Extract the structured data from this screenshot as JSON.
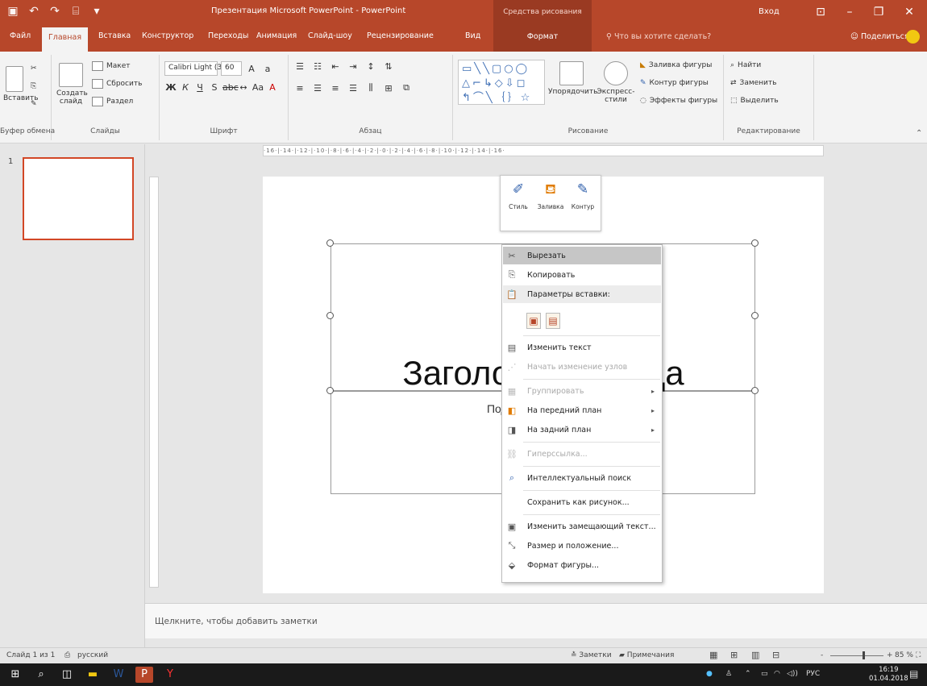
{
  "titlebar": {
    "document_title": "Презентация Microsoft PowerPoint - PowerPoint",
    "context_tools": "Средства рисования",
    "signin": "Вход"
  },
  "tabs": {
    "file": "Файл",
    "home": "Главная",
    "insert": "Вставка",
    "design": "Конструктор",
    "transitions": "Переходы",
    "animations": "Анимация",
    "slideshow": "Слайд-шоу",
    "review": "Рецензирование",
    "view": "Вид",
    "format": "Формат",
    "tell_me": "Что вы хотите сделать?",
    "share": "Поделиться"
  },
  "ribbon": {
    "clipboard": {
      "paste": "Вставить",
      "label": "Буфер обмена"
    },
    "slides": {
      "new_slide_1": "Создать",
      "new_slide_2": "слайд",
      "layout": "Макет",
      "reset": "Сбросить",
      "section": "Раздел",
      "label": "Слайды"
    },
    "font": {
      "name": "Calibri Light (З",
      "size": "60",
      "label": "Шрифт"
    },
    "paragraph": {
      "label": "Абзац"
    },
    "drawing": {
      "arrange": "Упорядочить",
      "quick_styles_1": "Экспресс-",
      "quick_styles_2": "стили",
      "shape_fill": "Заливка фигуры",
      "shape_outline": "Контур фигуры",
      "shape_effects": "Эффекты фигуры",
      "label": "Рисование"
    },
    "editing": {
      "find": "Найти",
      "replace": "Заменить",
      "select": "Выделить",
      "label": "Редактирование"
    }
  },
  "ruler": {
    "ticks": "·16·|·14·|·12·|·10·|·8·|·6·|·4·|·2·|·0·|·2·|·4·|·6·|·8·|·10·|·12·|·14·|·16·"
  },
  "thumbs": {
    "slide_number": "1"
  },
  "slide": {
    "title_text": "Заголовок слайда",
    "subtitle_text": "Подзаголовок слайда"
  },
  "mini_toolbar": {
    "style": "Стиль",
    "fill": "Заливка",
    "outline": "Контур"
  },
  "context_menu": {
    "items": [
      {
        "label": "Вырезать",
        "icon": "✂",
        "state": "hover"
      },
      {
        "label": "Копировать",
        "icon": "⎘",
        "state": "normal"
      },
      {
        "label": "Параметры вставки:",
        "icon": "📋",
        "state": "header"
      },
      {
        "label": "Изменить текст",
        "icon": "▤",
        "state": "normal"
      },
      {
        "label": "Начать изменение узлов",
        "icon": "⋰",
        "state": "disabled"
      },
      {
        "label": "Группировать",
        "icon": "▦",
        "state": "disabled",
        "submenu": true
      },
      {
        "label": "На передний план",
        "icon": "◧",
        "state": "normal",
        "submenu": true
      },
      {
        "label": "На задний план",
        "icon": "◨",
        "state": "normal",
        "submenu": true
      },
      {
        "label": "Гиперссылка...",
        "icon": "⛓",
        "state": "disabled"
      },
      {
        "label": "Интеллектуальный поиск",
        "icon": "⌕",
        "state": "normal"
      },
      {
        "label": "Сохранить как рисунок...",
        "icon": "",
        "state": "normal"
      },
      {
        "label": "Изменить замещающий текст...",
        "icon": "▣",
        "state": "normal"
      },
      {
        "label": "Размер и положение...",
        "icon": "⤡",
        "state": "normal"
      },
      {
        "label": "Формат фигуры...",
        "icon": "⬙",
        "state": "normal"
      }
    ]
  },
  "notes": {
    "placeholder": "Щелкните, чтобы добавить заметки"
  },
  "status": {
    "slide_count": "Слайд 1 из 1",
    "language": "русский",
    "notes_btn": "Заметки",
    "comments_btn": "Примечания",
    "zoom_minus": "-",
    "zoom_plus": "+",
    "zoom_value": "85 %",
    "zoom_fraction": 0.62
  },
  "taskbar": {
    "lang": "РУС",
    "time": "16:19",
    "date": "01.04.2018"
  },
  "colors": {
    "brand": "#b7472a",
    "contextual": "#9a3a22",
    "selected_thumb": "#d24726"
  }
}
